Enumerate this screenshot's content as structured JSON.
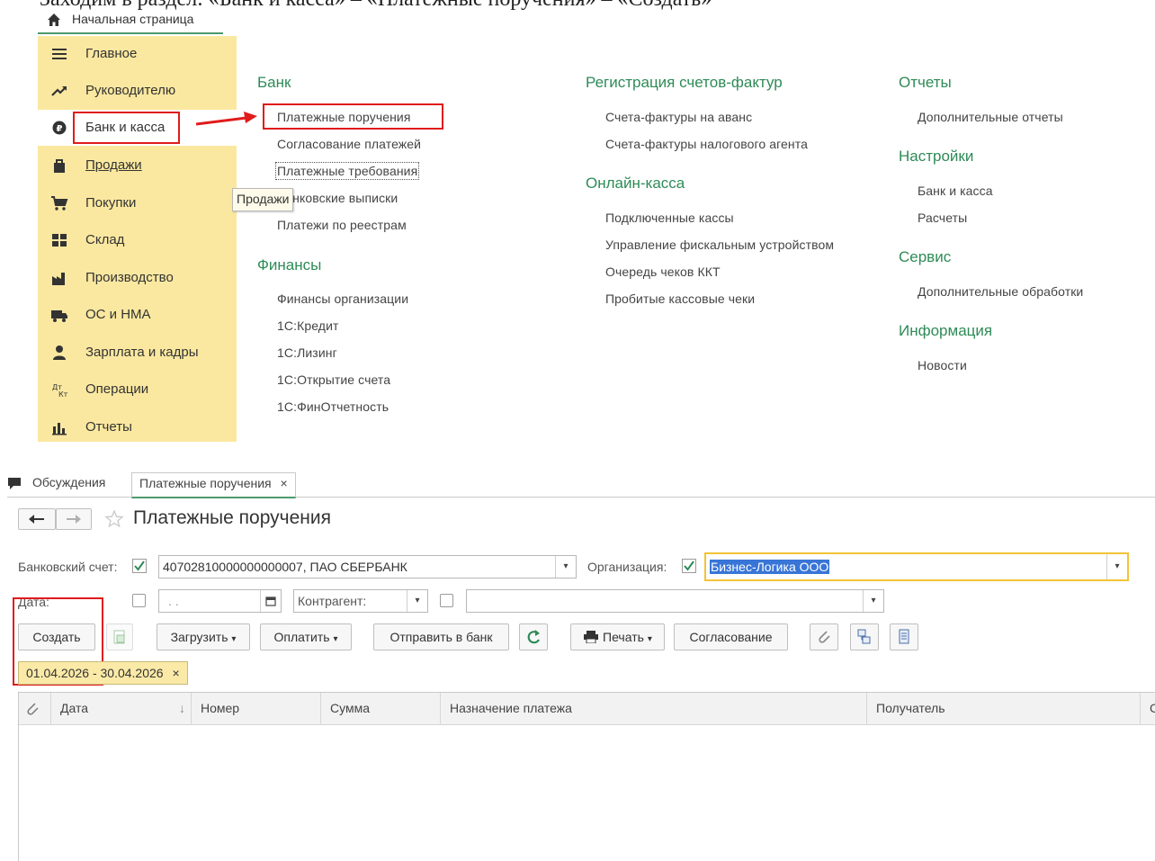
{
  "doc_heading": "Заходим в раздел: «Банк и касса» – «Платежные поручения» – «Создать»",
  "home_tab": {
    "label": "Начальная страница"
  },
  "sidebar": {
    "items": [
      {
        "label": "Главное",
        "icon": "menu-lines-icon"
      },
      {
        "label": "Руководителю",
        "icon": "trend-icon"
      },
      {
        "label": "Банк и касса",
        "icon": "money-circle-icon"
      },
      {
        "label": "Продажи",
        "icon": "bag-icon"
      },
      {
        "label": "Покупки",
        "icon": "cart-icon"
      },
      {
        "label": "Склад",
        "icon": "warehouse-icon"
      },
      {
        "label": "Производство",
        "icon": "factory-icon"
      },
      {
        "label": "ОС и НМА",
        "icon": "truck-icon"
      },
      {
        "label": "Зарплата и кадры",
        "icon": "person-icon"
      },
      {
        "label": "Операции",
        "icon": "operations-icon"
      },
      {
        "label": "Отчеты",
        "icon": "bar-chart-icon"
      }
    ],
    "tooltip": "Продажи"
  },
  "menu": {
    "bank": {
      "title": "Банк",
      "items": [
        "Платежные поручения",
        "Согласование платежей",
        "Платежные требования",
        "Банковские выписки",
        "Платежи по реестрам"
      ]
    },
    "finance": {
      "title": "Финансы",
      "items": [
        "Финансы организации",
        "1С:Кредит",
        "1С:Лизинг",
        "1С:Открытие счета",
        "1С:ФинОтчетность"
      ]
    },
    "invoices": {
      "title": "Регистрация счетов-фактур",
      "items": [
        "Счета-фактуры на аванс",
        "Счета-фактуры налогового агента"
      ]
    },
    "online_cash": {
      "title": "Онлайн-касса",
      "items": [
        "Подключенные кассы",
        "Управление фискальным устройством",
        "Очередь чеков ККТ",
        "Пробитые кассовые чеки"
      ]
    },
    "reports": {
      "title": "Отчеты",
      "items": [
        "Дополнительные отчеты"
      ]
    },
    "settings": {
      "title": "Настройки",
      "items": [
        "Банк и касса",
        "Расчеты"
      ]
    },
    "service": {
      "title": "Сервис",
      "items": [
        "Дополнительные обработки"
      ]
    },
    "info": {
      "title": "Информация",
      "items": [
        "Новости"
      ]
    }
  },
  "form": {
    "tabs": [
      "Обсуждения",
      "Платежные поручения"
    ],
    "title": "Платежные поручения",
    "bank_account_label": "Банковский счет:",
    "bank_account_value": "40702810000000000007, ПАО СБЕРБАНК",
    "org_label": "Организация:",
    "org_value": "Бизнес-Логика ООО",
    "date_label": "Дата:",
    "date_value": ". .",
    "counterparty_placeholder": "Контрагент:",
    "buttons": {
      "create": "Создать",
      "load": "Загрузить",
      "pay": "Оплатить",
      "send": "Отправить в банк",
      "print": "Печать",
      "approve": "Согласование"
    },
    "filter": "01.04.2026 - 30.04.2026",
    "columns": [
      "Дата",
      "Номер",
      "Сумма",
      "Назначение платежа",
      "Получатель",
      "С"
    ]
  },
  "colors": {
    "section_title": "#2e8b57",
    "sidebar_bg": "#fbe8a0",
    "highlight": "#e01b1b",
    "focus": "#f2c335"
  }
}
